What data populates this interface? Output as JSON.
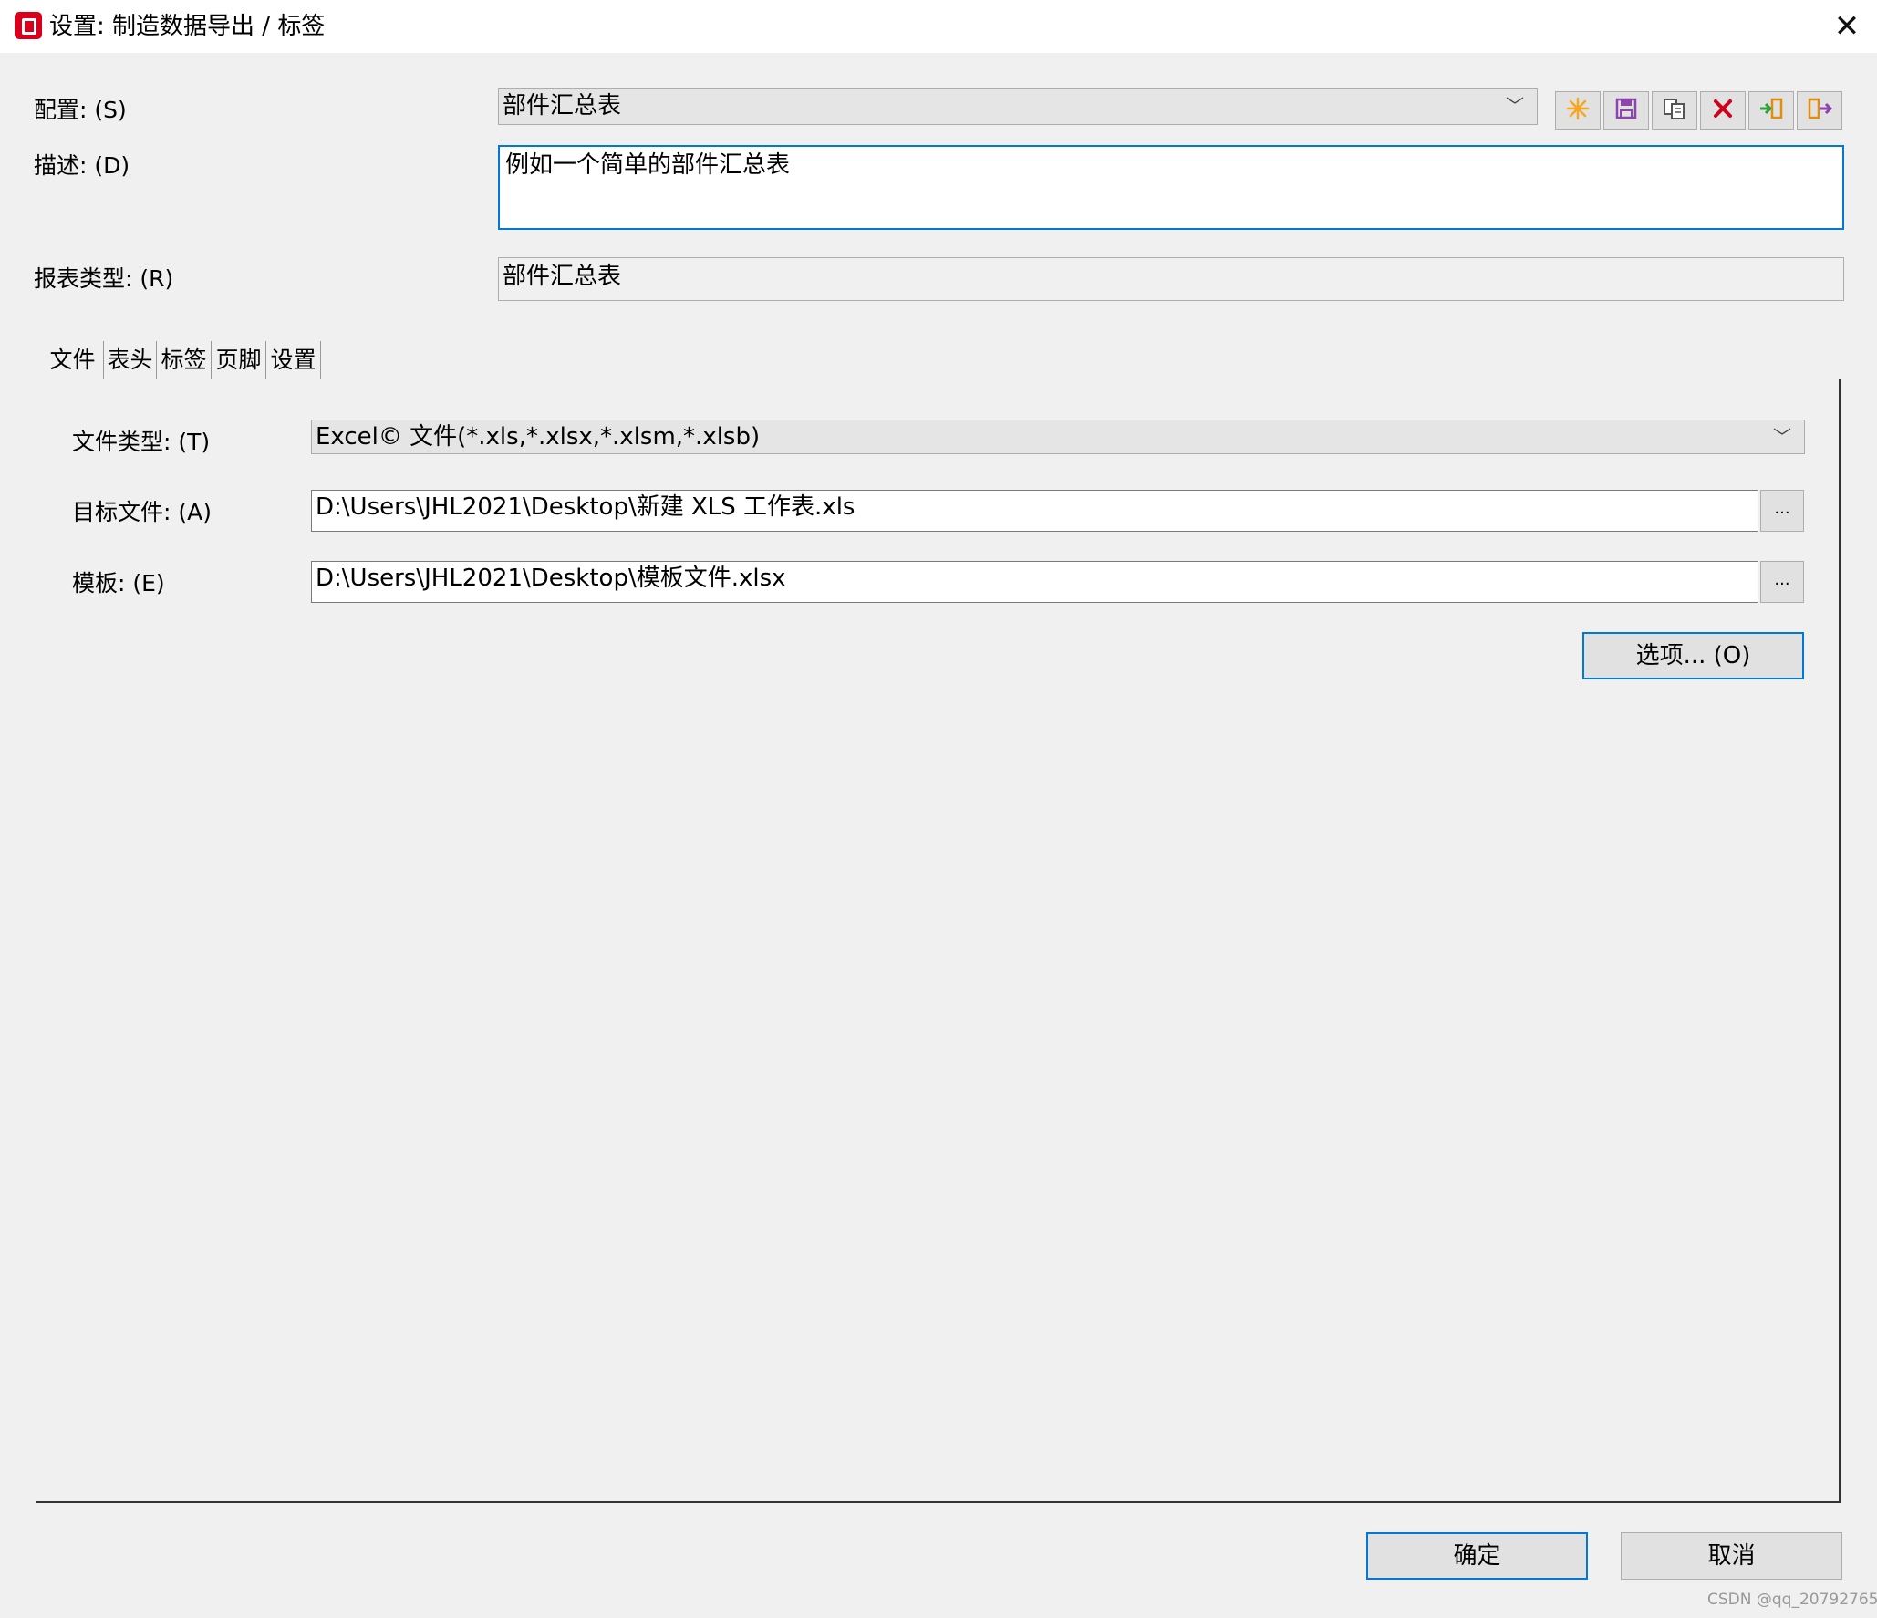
{
  "window": {
    "title": "设置: 制造数据导出 / 标签",
    "close_label": "✕"
  },
  "form": {
    "config_label": "配置: (S)",
    "config_value": "部件汇总表",
    "desc_label": "描述: (D)",
    "desc_value": "例如一个简单的部件汇总表",
    "report_type_label": "报表类型: (R)",
    "report_type_value": "部件汇总表"
  },
  "toolbar": {
    "icons": [
      "new-icon",
      "save-icon",
      "copy-icon",
      "delete-icon",
      "import-icon",
      "export-icon"
    ]
  },
  "tabs": [
    {
      "label": "文件"
    },
    {
      "label": "表头"
    },
    {
      "label": "标签"
    },
    {
      "label": "页脚"
    },
    {
      "label": "设置"
    }
  ],
  "file_tab": {
    "file_type_label": "文件类型: (T)",
    "file_type_value": "Excel© 文件(*.xls,*.xlsx,*.xlsm,*.xlsb)",
    "target_label": "目标文件: (A)",
    "target_value": "D:\\Users\\JHL2021\\Desktop\\新建 XLS 工作表.xls",
    "template_label": "模板: (E)",
    "template_value": "D:\\Users\\JHL2021\\Desktop\\模板文件.xlsx",
    "browse_label": "...",
    "options_label": "选项... (O)"
  },
  "footer": {
    "ok_label": "确定",
    "cancel_label": "取消"
  },
  "watermark": "CSDN @qq_20792765",
  "colors": {
    "accent": "#0078d7",
    "app_icon": "#d9001b",
    "new_icon": "#f5a623",
    "delete_icon": "#d0021b"
  }
}
